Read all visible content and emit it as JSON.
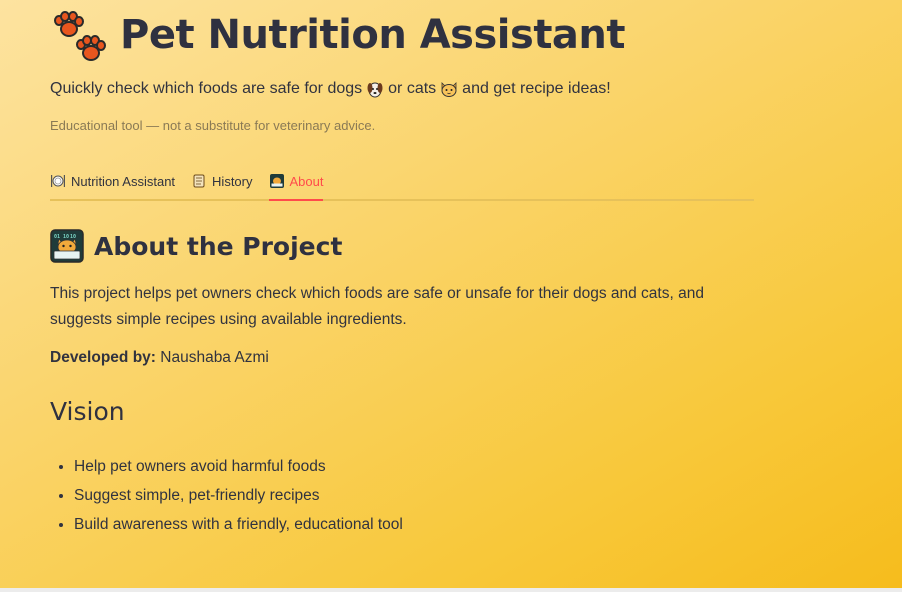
{
  "header": {
    "title": "Pet Nutrition Assistant",
    "title_icon": "paw-prints-icon",
    "subtitle_part1": "Quickly check which foods are safe for dogs",
    "subtitle_dog_icon": "dog-face-icon",
    "subtitle_part2": "or cats",
    "subtitle_cat_icon": "cat-face-icon",
    "subtitle_part3": "and get recipe ideas!",
    "disclaimer": "Educational tool — not a substitute for veterinary advice."
  },
  "tabs": [
    {
      "label": "Nutrition Assistant",
      "icon": "plate-cutlery-icon",
      "active": false
    },
    {
      "label": "History",
      "icon": "scroll-icon",
      "active": false
    },
    {
      "label": "About",
      "icon": "cat-laptop-icon",
      "active": true
    }
  ],
  "about": {
    "heading": "About the Project",
    "heading_icon": "cat-laptop-icon",
    "description": "This project helps pet owners check which foods are safe or unsafe for their dogs and cats, and suggests simple recipes using available ingredients.",
    "developed_by_label": "Developed by:",
    "developer": "Naushaba Azmi"
  },
  "vision": {
    "heading": "Vision",
    "items": [
      "Help pet owners avoid harmful foods",
      "Suggest simple, pet-friendly recipes",
      "Build awareness with a friendly, educational tool"
    ]
  },
  "colors": {
    "accent": "#ff4b4b",
    "text": "#31333f",
    "paw": "#e8561e"
  }
}
